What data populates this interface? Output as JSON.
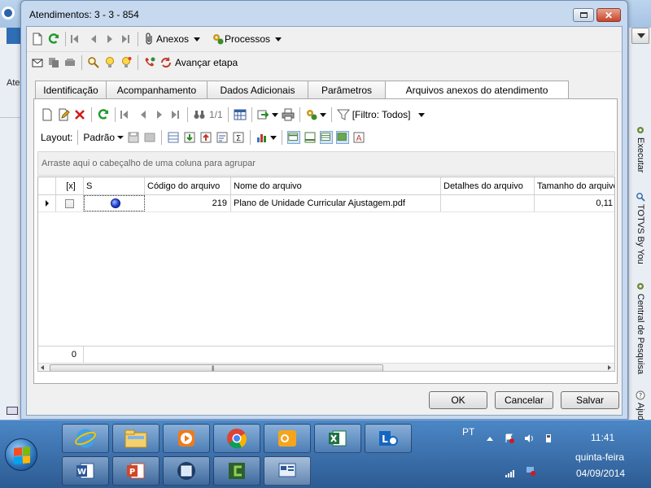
{
  "window": {
    "title": "Atendimentos: 3 - 3 - 854",
    "close_glyph": "✕"
  },
  "background": {
    "left_label": "Atei",
    "side_items": [
      {
        "label": "Executar",
        "icon": "gear-icon"
      },
      {
        "label": "TOTVS By You",
        "icon": "search-icon"
      },
      {
        "label": "Central de Pesquisa",
        "icon": "gear-icon"
      },
      {
        "label": "Ajuda",
        "icon": "help-icon"
      }
    ]
  },
  "toolbar1": {
    "anexos_label": "Anexos",
    "processos_label": "Processos"
  },
  "toolbar2": {
    "avancar_label": "Avançar etapa"
  },
  "tabs": [
    {
      "label": "Identificação",
      "active": false
    },
    {
      "label": "Acompanhamento",
      "active": false
    },
    {
      "label": "Dados Adicionais",
      "active": false
    },
    {
      "label": "Parâmetros",
      "active": false
    },
    {
      "label": "Arquivos anexos do atendimento",
      "active": true
    }
  ],
  "grid_toolbar": {
    "record_counter": "1/1",
    "filter_label": "[Filtro: Todos]",
    "layout_label": "Layout:",
    "layout_value": "Padrão"
  },
  "grid": {
    "group_hint": "Arraste aqui o cabeçalho de uma coluna para agrupar",
    "columns": [
      "[x]",
      "S",
      "Código do arquivo",
      "Nome do arquivo",
      "Detalhes do arquivo",
      "Tamanho do arquivo"
    ],
    "rows": [
      {
        "checked": false,
        "status": "blue",
        "codigo": "219",
        "nome": "Plano de Unidade Curricular Ajustagem.pdf",
        "detalhes": "",
        "tamanho": "0,11"
      }
    ],
    "footer_count": "0"
  },
  "buttons": {
    "ok": "OK",
    "cancel": "Cancelar",
    "save": "Salvar"
  },
  "taskbar": {
    "language": "PT",
    "time": "11:41",
    "weekday": "quinta-feira",
    "date": "04/09/2014"
  },
  "colors": {
    "accent": "#3b6ea5",
    "dialog_frame": "#c7d9ef",
    "status_dot": "#1f3fd6",
    "delete_red": "#d11a1a",
    "refresh_green": "#1f9a2a"
  }
}
